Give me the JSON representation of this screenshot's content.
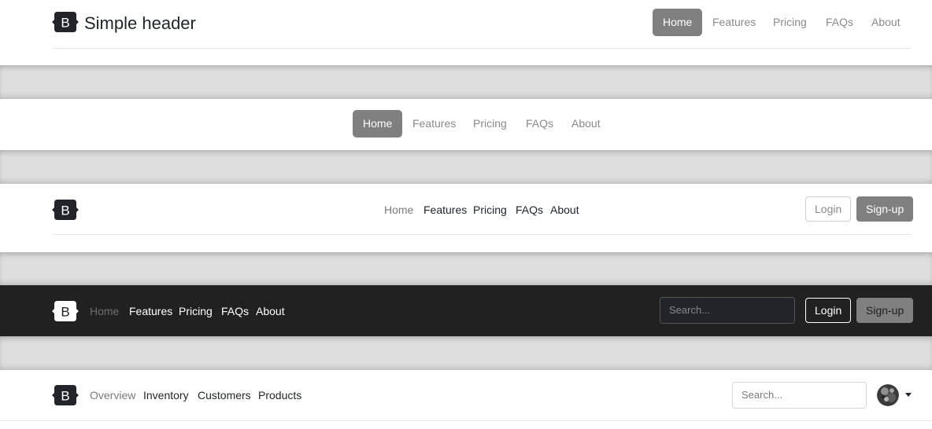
{
  "header1": {
    "brand_text": "Simple header",
    "nav": [
      "Home",
      "Features",
      "Pricing",
      "FAQs",
      "About"
    ],
    "active": "Home"
  },
  "header2": {
    "nav": [
      "Home",
      "Features",
      "Pricing",
      "FAQs",
      "About"
    ],
    "active": "Home"
  },
  "header3": {
    "nav": [
      "Home",
      "Features",
      "Pricing",
      "FAQs",
      "About"
    ],
    "login_label": "Login",
    "signup_label": "Sign-up"
  },
  "header4": {
    "nav": [
      "Home",
      "Features",
      "Pricing",
      "FAQs",
      "About"
    ],
    "search_placeholder": "Search...",
    "login_label": "Login",
    "signup_label": "Sign-up"
  },
  "header5": {
    "nav": [
      "Overview",
      "Inventory",
      "Customers",
      "Products"
    ],
    "search_placeholder": "Search..."
  },
  "logo_letter": "B",
  "colors": {
    "dark_bar": "#212121",
    "active_pill": "#808080",
    "divider_band": "#dedede"
  }
}
